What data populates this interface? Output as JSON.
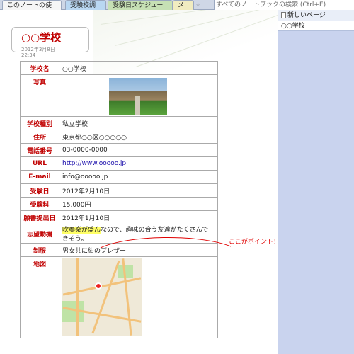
{
  "tabs": [
    {
      "label": "このノートの使い方"
    },
    {
      "label": "受験校調査"
    },
    {
      "label": "受験日スケジュール"
    },
    {
      "label": "メモ"
    }
  ],
  "new_tab_icon": "star-tab-icon",
  "search_placeholder": "すべてのノートブックの検索 (Ctrl+E)",
  "pages_pane": {
    "new_page_label": "新しいページ",
    "items": [
      "○○学校"
    ]
  },
  "page": {
    "title": "○○学校",
    "date": "2012年3月8日",
    "time": "22:34"
  },
  "rows": {
    "school_name": {
      "label": "学校名",
      "value": "○○学校"
    },
    "photo": {
      "label": "写真"
    },
    "type": {
      "label": "学校種別",
      "value": "私立学校"
    },
    "address": {
      "label": "住所",
      "value": "東京都○○区○○○○○"
    },
    "phone": {
      "label": "電話番号",
      "value": "03-0000-0000"
    },
    "url": {
      "label": "URL",
      "value": "http://www.ooooo.jp"
    },
    "email": {
      "label": "E-mail",
      "value": "info@ooooo.jp"
    },
    "exam_date": {
      "label": "受験日",
      "value": "2012年2月10日"
    },
    "fee": {
      "label": "受験料",
      "value": "15,000円"
    },
    "deadline": {
      "label": "願書提出日",
      "value": "2012年1月10日"
    },
    "motive": {
      "label": "志望動機",
      "highlight": "吹奏楽が盛ん",
      "rest": "なので、趣味の合う友達がたくさんできそう。"
    },
    "uniform": {
      "label": "制服",
      "value": "男女共に紺のブレザー"
    },
    "map": {
      "label": "地図"
    }
  },
  "callout": "ここがポイント！",
  "colors": {
    "label_red": "#c00000",
    "highlight": "#ffff66",
    "pane": "#c9d3ee"
  }
}
